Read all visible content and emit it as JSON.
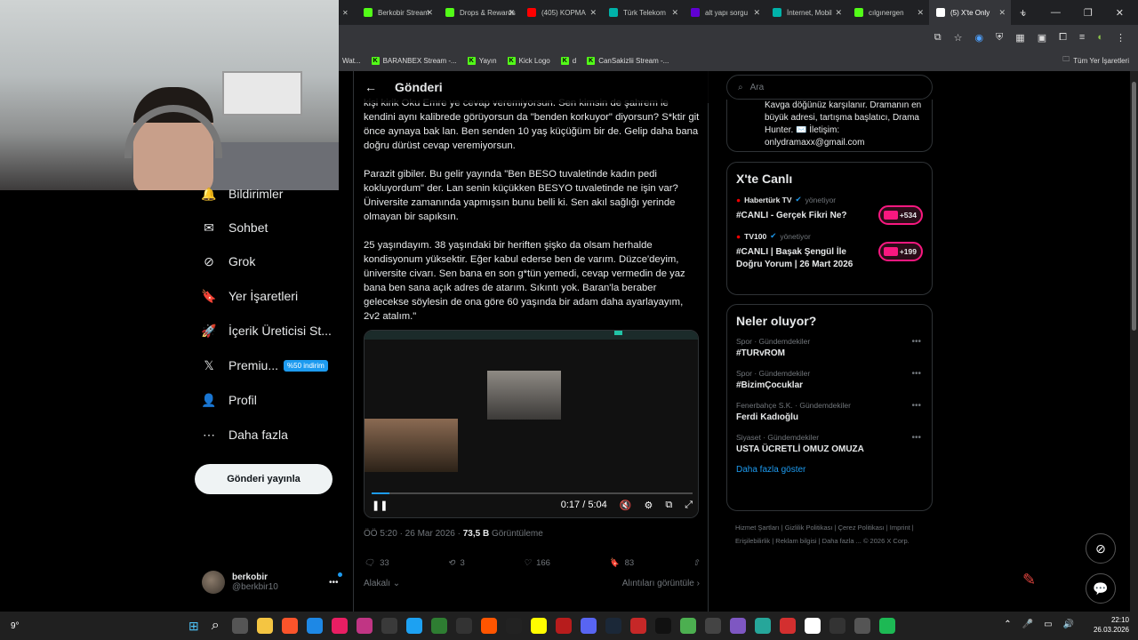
{
  "browser": {
    "tabs": [
      {
        "label": "Berkobir Stream",
        "icon": "kick-icon",
        "color": "#53fc18"
      },
      {
        "label": "Drops & Rewards",
        "icon": "kick-icon",
        "color": "#53fc18"
      },
      {
        "label": "(405) KOPMA",
        "icon": "youtube-icon",
        "color": "#ff0000"
      },
      {
        "label": "Türk Telekom",
        "icon": "telekom-icon",
        "color": "#00b2a9"
      },
      {
        "label": "alt yapı sorgu",
        "icon": "yahoo-icon",
        "color": "#6001d2"
      },
      {
        "label": "İnternet, Mobil",
        "icon": "telekom-icon",
        "color": "#00b2a9"
      },
      {
        "label": "cılgınergen",
        "icon": "kick-icon",
        "color": "#53fc18"
      },
      {
        "label": "(5) X'te Only",
        "icon": "x-icon",
        "color": "#ffffff",
        "active": true
      }
    ],
    "bookmarks": [
      {
        "label": "Wat..."
      },
      {
        "label": "BARANBEX Stream -..."
      },
      {
        "label": "Yayın"
      },
      {
        "label": "Kick Logo"
      },
      {
        "label": "d"
      },
      {
        "label": "CanSakizlii Stream -..."
      }
    ],
    "all_bookmarks": "Tüm Yer İşaretleri"
  },
  "nav": {
    "items": [
      {
        "label": "Bildirimler",
        "icon": "bell-icon",
        "glyph": "🔔"
      },
      {
        "label": "Sohbet",
        "icon": "mail-icon",
        "glyph": "✉"
      },
      {
        "label": "Grok",
        "icon": "grok-icon",
        "glyph": "⊘"
      },
      {
        "label": "Yer İşaretleri",
        "icon": "bookmark-icon",
        "glyph": "🔖"
      },
      {
        "label": "İçerik Üreticisi St...",
        "icon": "rocket-icon",
        "glyph": "🚀"
      },
      {
        "label": "Premium",
        "icon": "x-logo-icon",
        "glyph": "𝕏"
      },
      {
        "label": "Profil",
        "icon": "person-icon",
        "glyph": "👤"
      },
      {
        "label": "Daha fazla",
        "icon": "more-circle-icon",
        "glyph": "⋯"
      }
    ],
    "premium_badge": "%50 indirim",
    "post_button": "Gönderi yayınla",
    "profile": {
      "name": "berkobir",
      "handle": "@berkbir10"
    }
  },
  "post": {
    "header": "Gönderi",
    "paragraphs": [
      "kişi kirik Oku Emre ye cevap veremiyorsun. Sen kimsin de şahrem le kendini aynı kalibrede görüyorsun da \"benden korkuyor\" diyorsun? S*ktir git önce aynaya bak lan. Ben senden 10 yaş küçüğüm bir de. Gelip daha bana doğru dürüst cevap veremiyorsun.",
      "Parazit gibiler. Bu gelir yayında \"Ben BESO tuvaletinde kadın pedi kokluyordum\" der. Lan senin küçükken BESYO tuvaletinde ne işin var? Üniversite zamanında yapmışsın bunu belli ki. Sen akıl sağlığı yerinde olmayan bir sapıksın.",
      "25 yaşındayım. 38 yaşındaki bir heriften şişko da olsam herhalde kondisyonum yüksektir. Eğer kabul ederse ben de varım. Düzce'deyim, üniversite civarı. Sen bana en son g*tün yemedi, cevap vermedin de yaz bana ben sana açık adres de atarım. Sıkıntı yok. Baran'la beraber gelecekse söylesin de ona göre 60 yaşında bir adam daha ayarlayayım, 2v2 atalım.\""
    ],
    "video_time": "0:17 / 5:04",
    "video_progress": 0.056,
    "timestamp": "ÖÖ 5:20 · 26 Mar 2026 · ",
    "views": "73,5 B",
    "views_label": " Görüntüleme",
    "replies": "33",
    "reposts": "3",
    "likes": "166",
    "bookmarks": "83",
    "reply_sort": "Alakalı",
    "quotes_link": "Alıntıları görüntüle"
  },
  "right": {
    "search_placeholder": "Ara",
    "bio": "Kavga döğünüz karşılanır. Dramanın en büyük adresi, tartışma başlatıcı, Drama Hunter. ✉️ İletişim: onlydramaxx@gmail.com",
    "live_title": "X'te Canlı",
    "live": [
      {
        "host": "Habertürk TV",
        "role": "yönetiyor",
        "title": "#CANLI - Gerçek Fikri Ne?",
        "count": "+534"
      },
      {
        "host": "TV100",
        "role": "yönetiyor",
        "title": "#CANLI | Başak Şengül İle Doğru Yorum | 26 Mart 2026",
        "count": "+199"
      }
    ],
    "trends_title": "Neler oluyor?",
    "trends": [
      {
        "category": "Spor · Gündemdekiler",
        "name": "#TURvROM"
      },
      {
        "category": "Spor · Gündemdekiler",
        "name": "#BizimÇocuklar"
      },
      {
        "category": "Fenerbahçe S.K. · Gündemdekiler",
        "name": "Ferdi Kadıoğlu"
      },
      {
        "category": "Siyaset · Gündemdekiler",
        "name": "USTA ÜCRETLİ OMUZ OMUZA"
      }
    ],
    "show_more": "Daha fazla göster",
    "footer": "Hizmet Şartları  |  Gizlilik Politikası  |  Çerez Politikası  |  Imprint  |  Erişilebilirlik  |  Reklam bilgisi  |  Daha fazla ...  © 2026 X Corp."
  },
  "taskbar": {
    "time": "22:10",
    "date": "26.03.2026",
    "weather": "9°"
  }
}
